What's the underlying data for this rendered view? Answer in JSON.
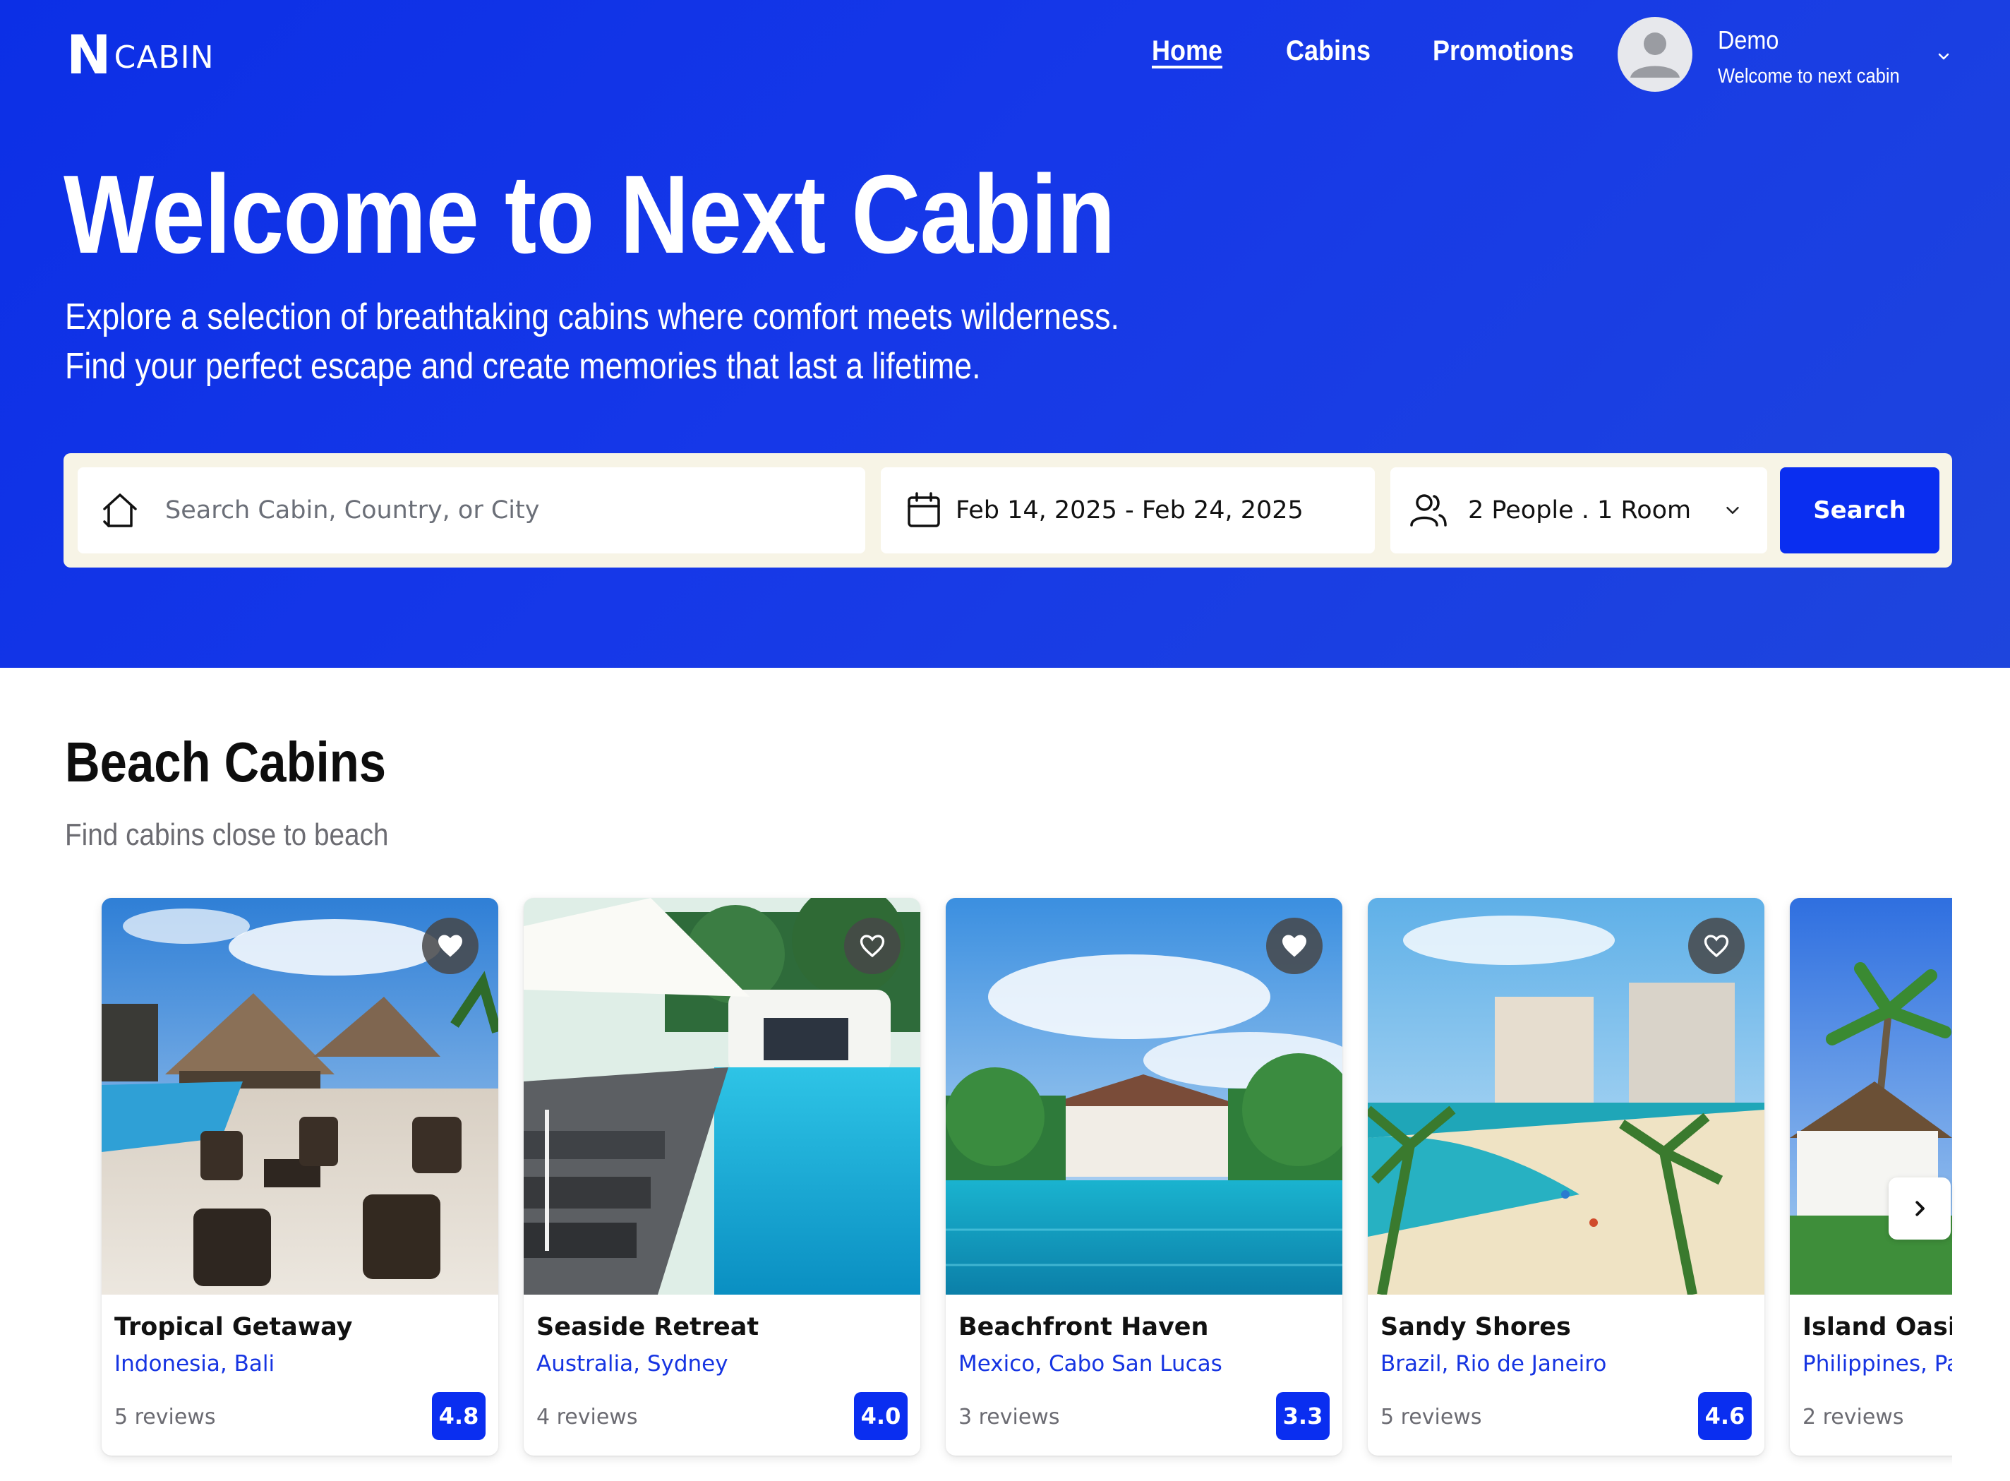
{
  "brand": {
    "logo_mark": "N",
    "logo_text": "CABIN"
  },
  "nav": {
    "items": [
      {
        "label": "Home",
        "active": true
      },
      {
        "label": "Cabins",
        "active": false
      },
      {
        "label": "Promotions",
        "active": false
      }
    ]
  },
  "user": {
    "name": "Demo",
    "subtitle": "Welcome to next cabin",
    "avatar_icon": "user-icon",
    "menu_icon": "chevron-down-icon"
  },
  "hero": {
    "title": "Welcome to Next Cabin",
    "subtitle_line1": "Explore a selection of breathtaking cabins where comfort meets wilderness.",
    "subtitle_line2": "Find your perfect escape and create memories that last a lifetime."
  },
  "search": {
    "destination_placeholder": "Search Cabin, Country, or City",
    "destination_value": "",
    "dates": "Feb 14, 2025 - Feb 24, 2025",
    "guests": "2 People . 1 Room",
    "button_label": "Search",
    "icons": [
      "home-icon",
      "calendar-icon",
      "users-icon",
      "chevron-down-icon"
    ]
  },
  "section": {
    "title": "Beach Cabins",
    "subtitle": "Find cabins close to beach",
    "cards": [
      {
        "name": "Tropical Getaway",
        "location": "Indonesia, Bali",
        "reviews": "5 reviews",
        "rating": "4.8",
        "favorited": true
      },
      {
        "name": "Seaside Retreat",
        "location": "Australia, Sydney",
        "reviews": "4 reviews",
        "rating": "4.0",
        "favorited": false
      },
      {
        "name": "Beachfront Haven",
        "location": "Mexico, Cabo San Lucas",
        "reviews": "3 reviews",
        "rating": "3.3",
        "favorited": true
      },
      {
        "name": "Sandy Shores",
        "location": "Brazil, Rio de Janeiro",
        "reviews": "5 reviews",
        "rating": "4.6",
        "favorited": false
      },
      {
        "name": "Island Oasis",
        "location": "Philippines, Pa",
        "reviews": "2 reviews",
        "rating": "",
        "favorited": false
      }
    ]
  },
  "colors": {
    "primary": "#0a2ef0",
    "hero_bg": "#1638e8",
    "location_text": "#1634e2",
    "search_bar_bg": "#f7f4e6"
  }
}
